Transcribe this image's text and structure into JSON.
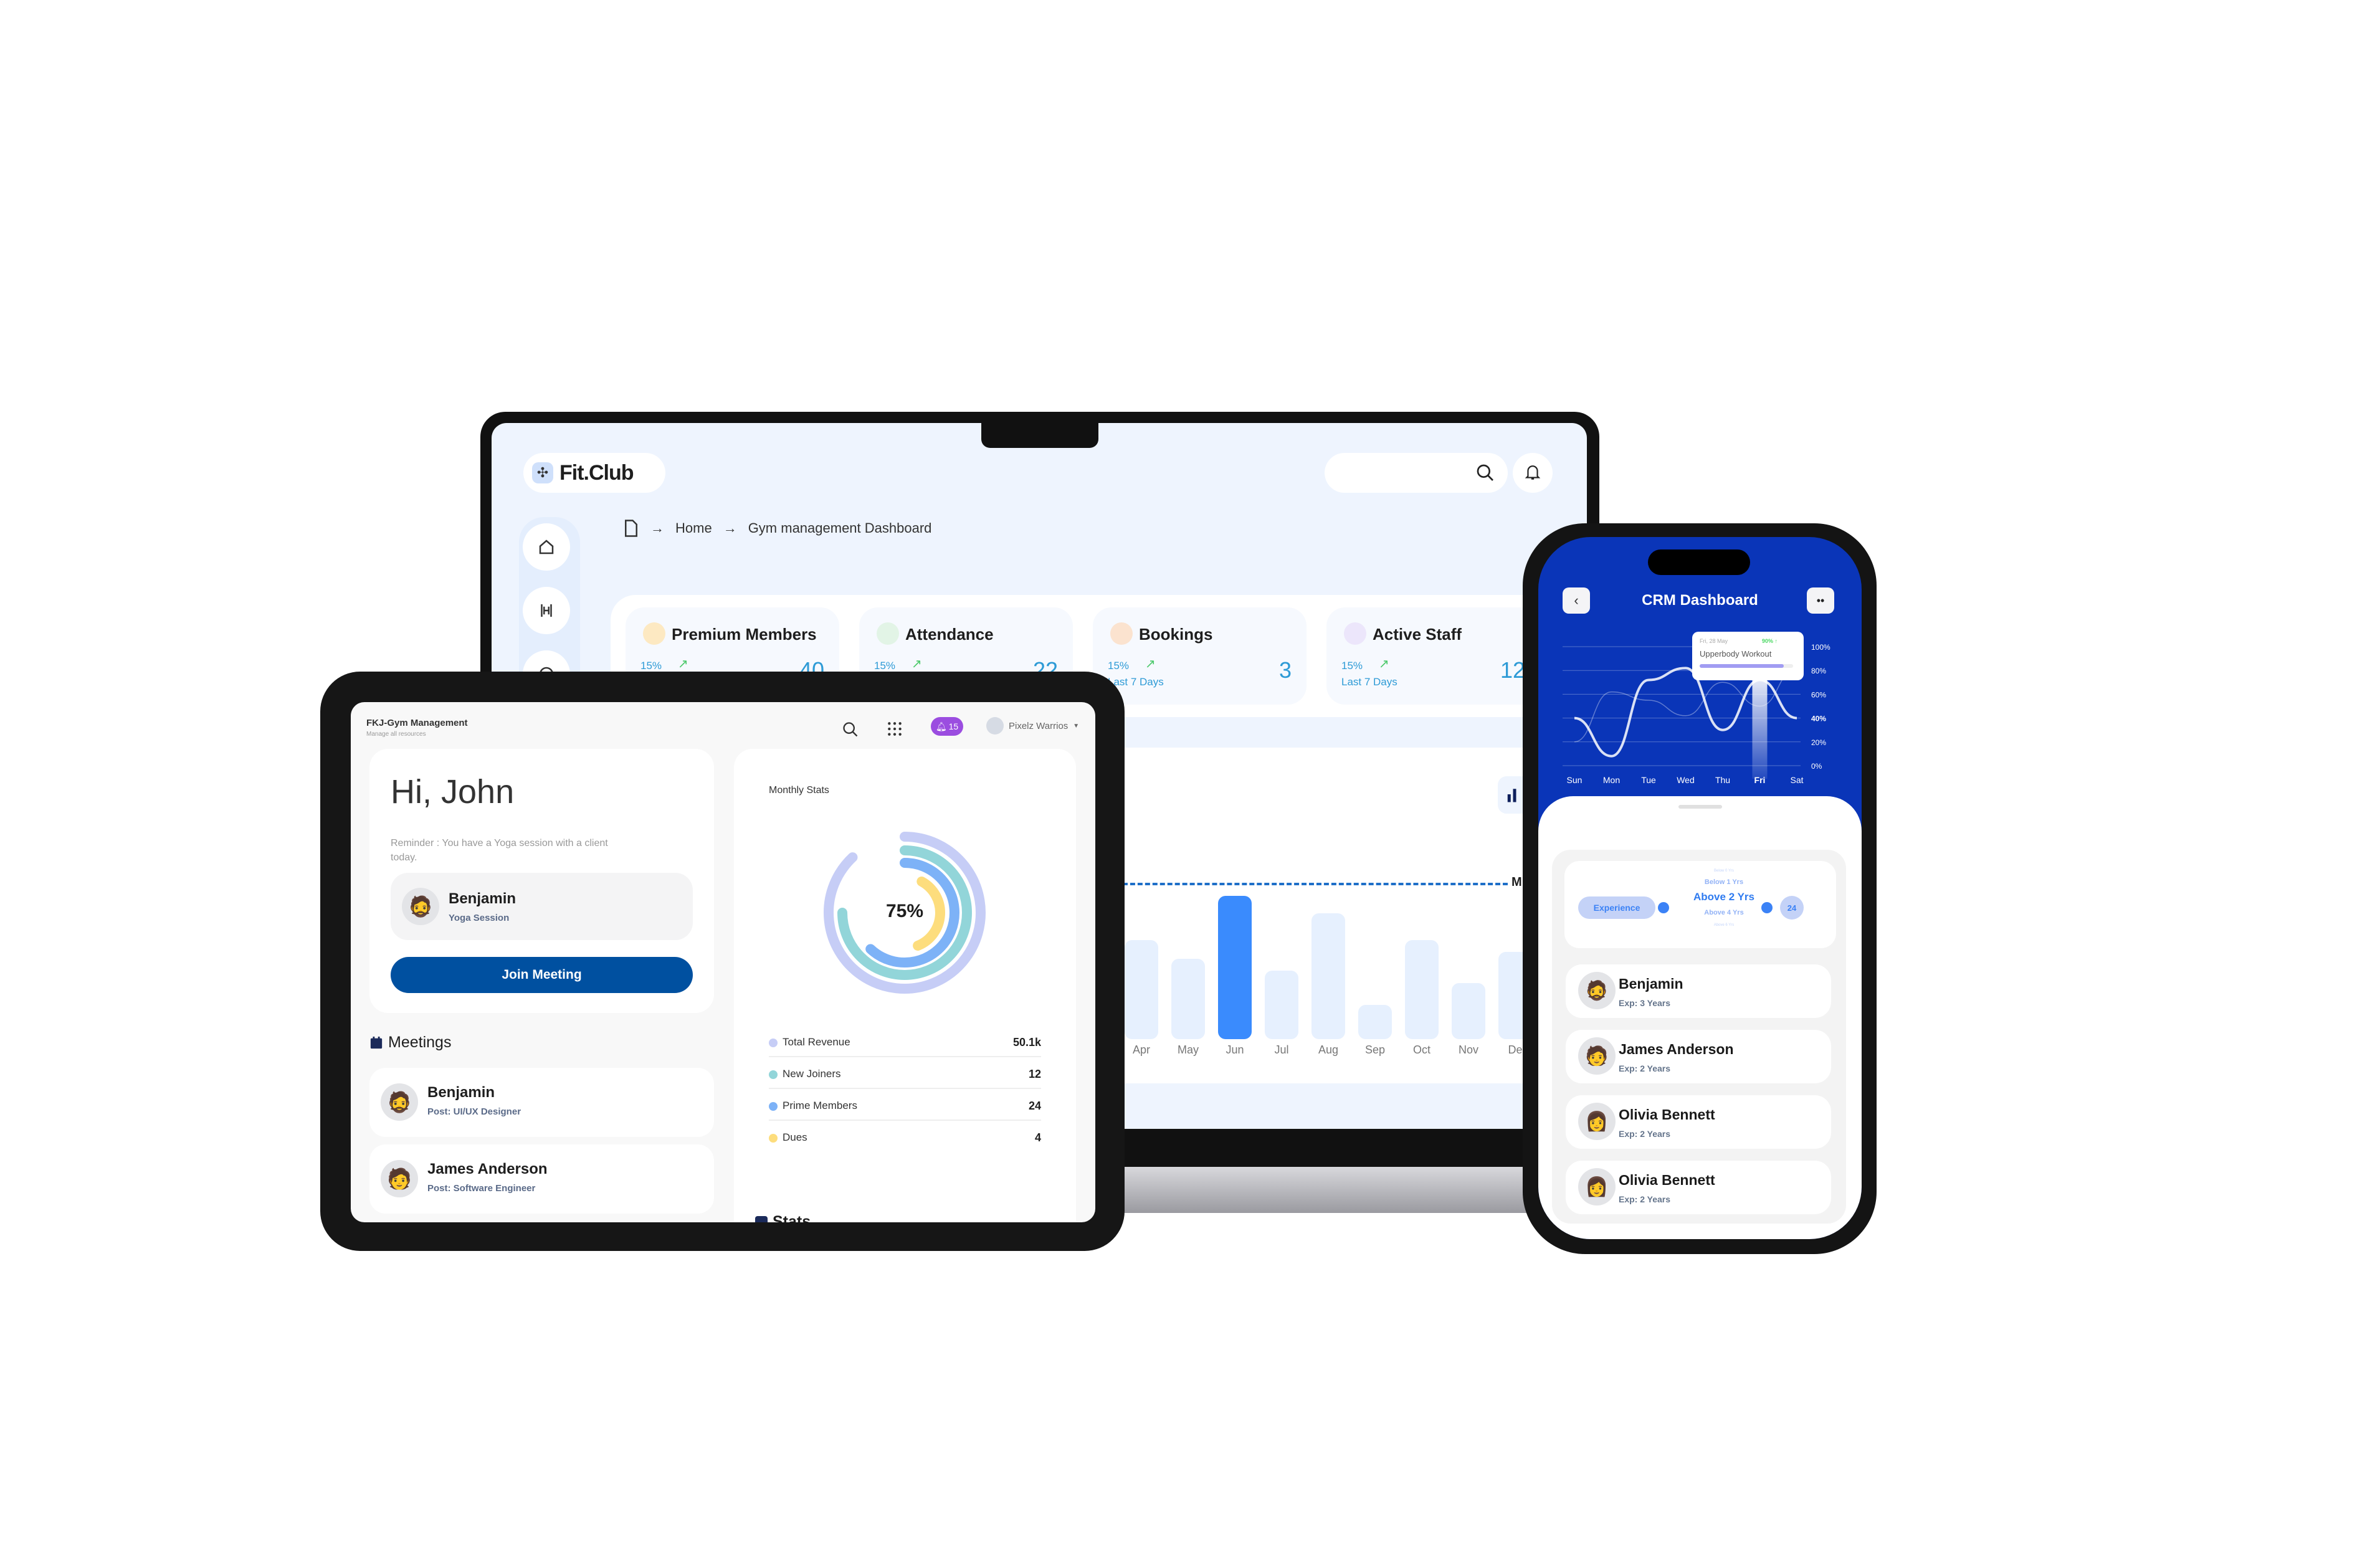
{
  "laptop": {
    "brand": "Fit.Club",
    "breadcrumb": [
      "Home",
      "Gym management Dashboard"
    ],
    "cards": [
      {
        "title": "Premium Members",
        "change": "15%",
        "period": "Last 7 Days",
        "value": "40",
        "icon_color": "#fde9c2"
      },
      {
        "title": "Attendance",
        "change": "15%",
        "period": "Last 7 Days",
        "value": "22",
        "icon_color": "#e2f4e6"
      },
      {
        "title": "Bookings",
        "change": "15%",
        "period": "Last 7 Days",
        "value": "3",
        "icon_color": "#fbe3cf"
      },
      {
        "title": "Active Staff",
        "change": "15%",
        "period": "Last 7 Days",
        "value": "12",
        "icon_color": "#ece6fb"
      }
    ],
    "marker_label": "M"
  },
  "chart_data": [
    {
      "type": "bar",
      "categories": [
        "Apr",
        "May",
        "Jun",
        "Jul",
        "Aug",
        "Sep",
        "Oct",
        "Nov",
        "De"
      ],
      "values": [
        69,
        56,
        100,
        48,
        88,
        24,
        69,
        39,
        61
      ],
      "highlight": "Jun",
      "colors": {
        "bar": "#e6f0fe",
        "highlight": "#3a8bfd",
        "reference_line": "#1e6fc8"
      }
    },
    {
      "type": "line",
      "title": "CRM Dashboard",
      "categories": [
        "Sun",
        "Mon",
        "Tue",
        "Wed",
        "Thu",
        "Fri",
        "Sat"
      ],
      "yticks": [
        "100%",
        "80%",
        "60%",
        "40%",
        "20%",
        "0%"
      ],
      "ylim": [
        0,
        100
      ],
      "highlight": "Fri",
      "series": [
        {
          "values": [
            40,
            8,
            72,
            82,
            30,
            72,
            40
          ]
        },
        {
          "values": [
            20,
            62,
            55,
            42,
            70,
            50,
            82
          ]
        }
      ],
      "tooltip": {
        "date": "Fri, 28 May",
        "change": "90% ↑",
        "label": "Upperbody Workout",
        "progress": 90
      }
    },
    {
      "type": "pie",
      "title": "Monthly Stats",
      "center_label": "75%",
      "rings": [
        {
          "color": "#c6cdf6",
          "fraction": 0.88
        },
        {
          "color": "#92d5d9",
          "fraction": 0.75
        },
        {
          "color": "#7db2f7",
          "fraction": 0.62
        },
        {
          "color": "#fddd7d",
          "fraction": 0.36
        }
      ],
      "legend": [
        {
          "label": "Total Revenue",
          "value": "50.1k",
          "color": "#c6cdf6"
        },
        {
          "label": "New Joiners",
          "value": "12",
          "color": "#92d5d9"
        },
        {
          "label": "Prime Members",
          "value": "24",
          "color": "#7db2f7"
        },
        {
          "label": "Dues",
          "value": "4",
          "color": "#fddd7d"
        }
      ]
    }
  ],
  "tablet": {
    "app_title": "FKJ-Gym Management",
    "app_subtitle": "Manage all resources",
    "notif_count": "15",
    "user_name": "Pixelz Warrios",
    "greeting": "Hi, John",
    "reminder": "Reminder : You have a Yoga session with a client today.",
    "session": {
      "name": "Benjamin",
      "type": "Yoga Session"
    },
    "join_button": "Join Meeting",
    "meetings_title": "Meetings",
    "meetings": [
      {
        "name": "Benjamin",
        "post": "Post: UI/UX Designer"
      },
      {
        "name": "James Anderson",
        "post": "Post: Software Engineer"
      }
    ],
    "stats_title": "Stats",
    "accent": "#0050a0"
  },
  "phone": {
    "title": "CRM Dashboard",
    "filter_label": "Experience",
    "picker": [
      "Below 0 Yrs",
      "Below 1 Yrs",
      "Above 2 Yrs",
      "Above 4 Yrs",
      "Above 6 Yrs"
    ],
    "count": "24",
    "people": [
      {
        "name": "Benjamin",
        "exp": "Exp: 3 Years"
      },
      {
        "name": "James Anderson",
        "exp": "Exp: 2 Years"
      },
      {
        "name": "Olivia Bennett",
        "exp": "Exp: 2 Years"
      },
      {
        "name": "Olivia Bennett",
        "exp": "Exp: 2 Years"
      }
    ]
  }
}
